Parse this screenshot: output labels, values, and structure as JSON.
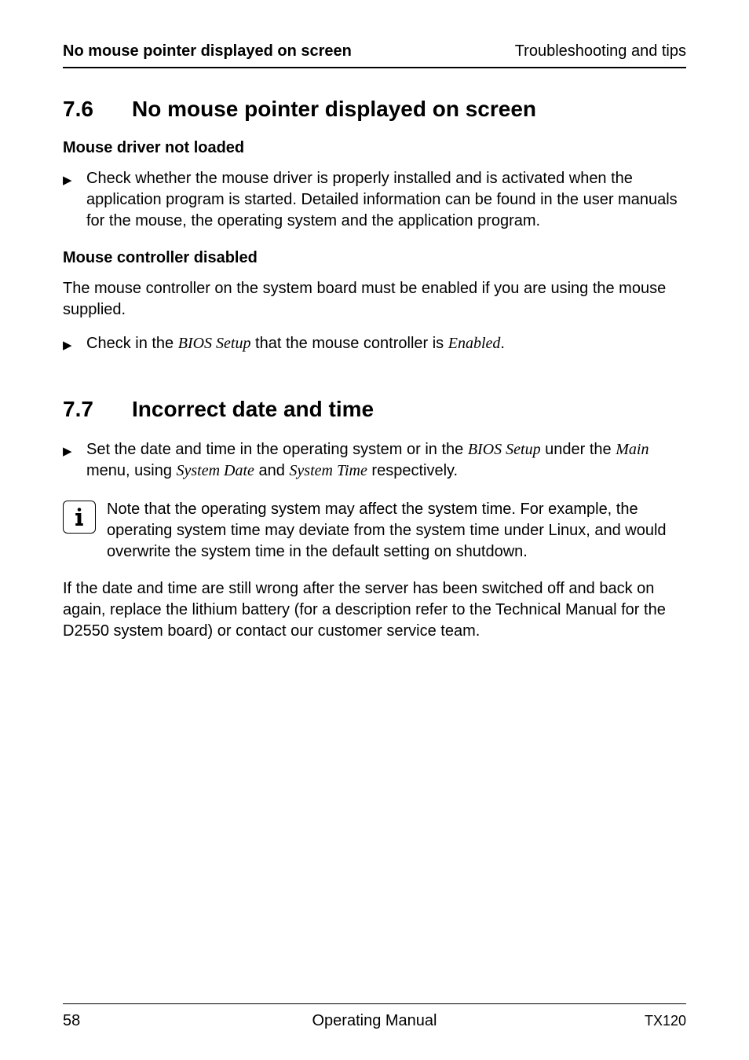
{
  "header": {
    "left": "No mouse pointer displayed on screen",
    "right": "Troubleshooting and tips"
  },
  "section76": {
    "number": "7.6",
    "title": "No mouse pointer displayed on screen",
    "sub1_title": "Mouse driver not loaded",
    "sub1_bullet": "Check whether the mouse driver is properly installed and is activated when the application program is started. Detailed information can be found in the user manuals for the mouse, the operating system and the application program.",
    "sub2_title": "Mouse controller disabled",
    "sub2_para": "The mouse controller on the system board must be enabled if you are using the mouse supplied.",
    "sub2_bullet_pre": "Check in the ",
    "sub2_bullet_it1": "BIOS Setup",
    "sub2_bullet_mid": " that the mouse controller is ",
    "sub2_bullet_it2": "Enabled",
    "sub2_bullet_end": "."
  },
  "section77": {
    "number": "7.7",
    "title": "Incorrect date and time",
    "bullet_pre": "Set the date and time in the operating system or in the ",
    "bullet_it1": "BIOS Setup",
    "bullet_mid1": " under the ",
    "bullet_it2": "Main",
    "bullet_mid2": " menu, using ",
    "bullet_it3": "System Date",
    "bullet_mid3": " and ",
    "bullet_it4": "System Time",
    "bullet_end": " respectively.",
    "info_text": "Note that the operating system may affect the system time. For example, the operating system time may deviate from the system time under Linux, and would overwrite the system time in the default setting on shutdown.",
    "final_para": "If the date and time are still wrong after the server has been switched off and back on again, replace the lithium battery (for a description refer to the Technical Manual for the D2550 system board) or contact our customer service team."
  },
  "footer": {
    "page": "58",
    "center": "Operating Manual",
    "right": "TX120"
  }
}
